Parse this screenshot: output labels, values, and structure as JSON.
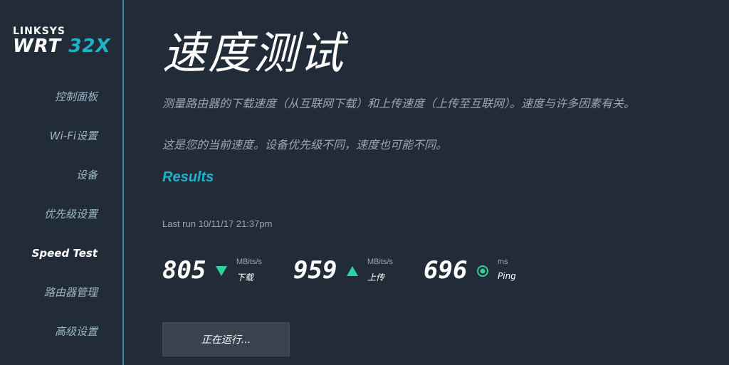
{
  "logo": {
    "brand": "LINKSYS",
    "model_prefix": "WRT",
    "model_accent": "32X"
  },
  "nav": {
    "items": [
      {
        "label": "控制面板"
      },
      {
        "label": "Wi-Fi设置"
      },
      {
        "label": "设备"
      },
      {
        "label": "优先级设置"
      },
      {
        "label": "Speed Test"
      },
      {
        "label": "路由器管理"
      },
      {
        "label": "高级设置"
      }
    ],
    "active_label": "Speed Test"
  },
  "page": {
    "title": "速度测试",
    "description1": "测量路由器的下载速度（从互联网下载）和上传速度（上传至互联网）。速度与许多因素有关。",
    "description2": "这是您的当前速度。设备优先级不同，速度也可能不同。"
  },
  "results": {
    "heading": "Results",
    "last_run": "Last run 10/11/17 21:37pm",
    "download": {
      "value": "805",
      "unit": "MBits/s",
      "label": "下载"
    },
    "upload": {
      "value": "959",
      "unit": "MBits/s",
      "label": "上传"
    },
    "ping": {
      "value": "696",
      "unit": "ms",
      "label": "Ping"
    }
  },
  "button": {
    "label": "正在运行..."
  },
  "colors": {
    "accent": "#1fb3c9",
    "green": "#2fd39a",
    "background": "#222c38"
  }
}
